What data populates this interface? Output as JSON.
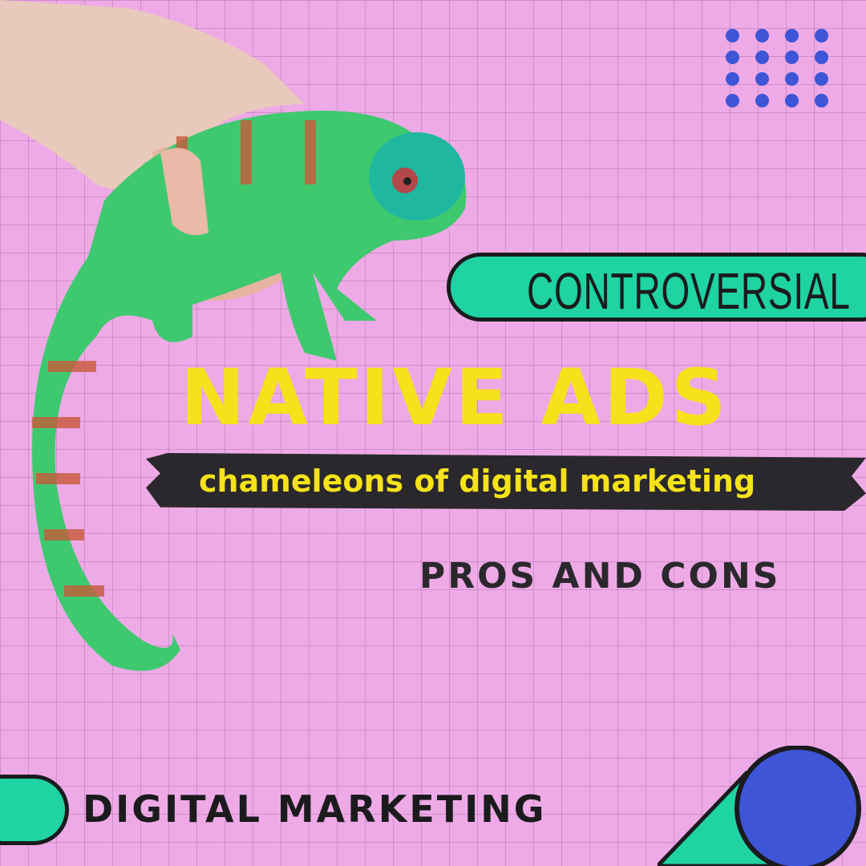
{
  "tag": "CONTROVERSIAL",
  "title": "NATIVE ADS",
  "subtitle": "chameleons of digital marketing",
  "section": "PROS AND CONS",
  "footer": "DIGITAL MARKETING",
  "colors": {
    "background": "#eeaae6",
    "accent_green": "#1fd3a2",
    "accent_blue": "#3d55d6",
    "title_yellow": "#f5e21a",
    "dark": "#2a282c"
  }
}
